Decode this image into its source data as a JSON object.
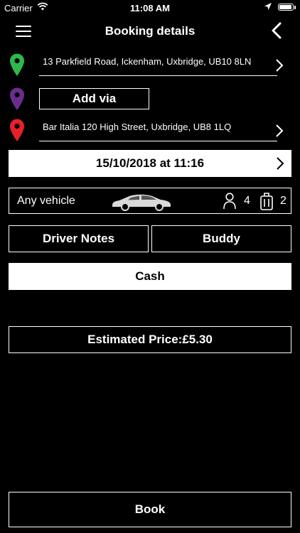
{
  "status_bar": {
    "carrier": "Carrier",
    "time": "11:08 AM",
    "battery_level": 0.95
  },
  "header": {
    "title": "Booking details"
  },
  "pickup": {
    "address": "13 Parkfield Road, Ickenham, Uxbridge, UB10 8LN",
    "pin_color": "#2eb84d"
  },
  "via": {
    "label": "Add via",
    "pin_color": "#6a2d8f"
  },
  "dropoff": {
    "address": "Bar Italia 120 High Street, Uxbridge, UB8 1LQ",
    "pin_color": "#e8202a"
  },
  "datetime": {
    "value": "15/10/2018 at 11:16"
  },
  "vehicle": {
    "label": "Any vehicle",
    "passengers": "4",
    "luggage": "2"
  },
  "buttons": {
    "driver_notes": "Driver Notes",
    "buddy": "Buddy",
    "payment": "Cash",
    "book": "Book"
  },
  "estimate": {
    "label": "Estimated Price",
    "separator": ":",
    "value": "£5.30"
  },
  "icons": [
    "menu-icon",
    "back-chevron-icon",
    "map-pin-icon",
    "chevron-right-icon",
    "car-icon",
    "person-icon",
    "luggage-icon",
    "wifi-icon",
    "location-arrow-icon",
    "battery-icon"
  ]
}
